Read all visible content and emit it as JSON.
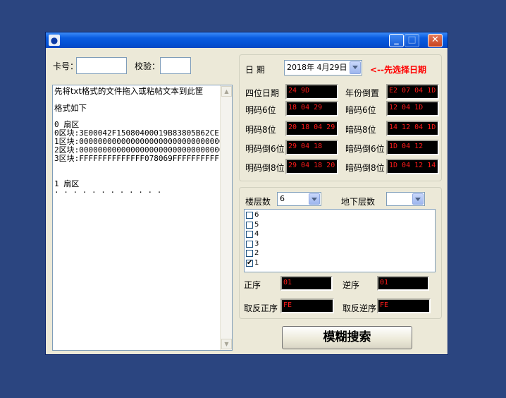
{
  "window": {
    "icon": "droplet-icon",
    "title": "",
    "controls": {
      "minimize": "_",
      "maximize": "□",
      "close": "✕"
    }
  },
  "card": {
    "label": "卡号：",
    "value": ""
  },
  "check": {
    "label": "校验：",
    "value": ""
  },
  "textarea": {
    "lines": [
      "先将txt格式的文件拖入或粘帖文本到此筐",
      "",
      "格式如下",
      "",
      "0 扇区",
      "0区块:3E00042F15080400019B83805B62CE1D",
      "1区块:00000000000000000000000000000000",
      "2区块:00000000000000000000000000000000",
      "3区块:FFFFFFFFFFFFFF078069FFFFFFFFFFFF",
      "",
      "",
      "1 扇区",
      "· · · · · · · · · · · ·"
    ]
  },
  "date": {
    "label": "日  期",
    "value": "2018年  4月29日",
    "hint": "<--先选择日期",
    "hint_color": "#ff0000"
  },
  "codes": [
    {
      "label": "四位日期",
      "value": "24 9D"
    },
    {
      "label": "年份倒置",
      "value": "E2 07 04 1D"
    },
    {
      "label": "明码6位",
      "value": "18 04 29"
    },
    {
      "label": "暗码6位",
      "value": "12 04 1D"
    },
    {
      "label": "明码8位",
      "value": "20 18 04 29"
    },
    {
      "label": "暗码8位",
      "value": "14 12 04 1D"
    },
    {
      "label": "明码倒6位",
      "value": "29 04 18"
    },
    {
      "label": "暗码倒6位",
      "value": "1D 04 12"
    },
    {
      "label": "明码倒8位",
      "value": "29 04 18 20"
    },
    {
      "label": "暗码倒8位",
      "value": "1D 04 12 14"
    }
  ],
  "floors": {
    "label": "楼层数",
    "value": "6",
    "basement_label": "地下层数",
    "basement_value": "",
    "items": [
      {
        "label": "6",
        "checked": false
      },
      {
        "label": "5",
        "checked": false
      },
      {
        "label": "4",
        "checked": false
      },
      {
        "label": "3",
        "checked": false
      },
      {
        "label": "2",
        "checked": false
      },
      {
        "label": "1",
        "checked": true
      }
    ]
  },
  "order": {
    "forward_label": "正序",
    "forward_value": "01",
    "reverse_label": "逆序",
    "reverse_value": "01",
    "inv_forward_label": "取反正序",
    "inv_forward_value": "FE",
    "inv_reverse_label": "取反逆序",
    "inv_reverse_value": "FE"
  },
  "search_button": "模糊搜索",
  "colors": {
    "desktop": "#2b4580",
    "lcd_bg": "#000000",
    "lcd_text": "#ff1a1a",
    "window_bg": "#ece9d8"
  }
}
